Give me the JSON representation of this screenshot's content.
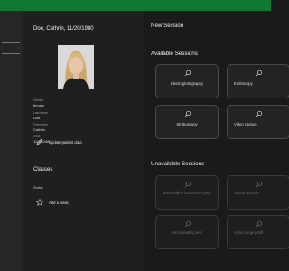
{
  "patient": {
    "name": "Doe, Cathrin, 11/20/1980",
    "fields": [
      {
        "label": "Gender",
        "value": "female"
      },
      {
        "label": "Last name",
        "value": "Doe"
      },
      {
        "label": "First name",
        "value": "Cathrin"
      },
      {
        "label": "DOB",
        "value": "11/20/1980"
      }
    ],
    "update_label": "Update patient data"
  },
  "classes": {
    "title": "Classes",
    "sorter": "Sorter",
    "add_label": "Add a class"
  },
  "main": {
    "new_session": "New Session",
    "available_title": "Available Sessions",
    "available": [
      {
        "label": "Electroglottography"
      },
      {
        "label": "Endoscopy"
      },
      {
        "label": "Stroboscopy"
      },
      {
        "label": "Video capture"
      }
    ],
    "unavailable_title": "Unavailable Sessions",
    "unavailable": [
      {
        "label": "Multi-stalline locations + pitch"
      },
      {
        "label": "Sound recordin"
      },
      {
        "label": "Vocal reading test"
      },
      {
        "label": "Voice range profil"
      }
    ]
  },
  "colors": {
    "accent": "#0f7a2f",
    "background": "#1a1a1a"
  },
  "icons": {
    "tile": "search-icon",
    "update": "pencil-icon",
    "add": "star-icon"
  }
}
